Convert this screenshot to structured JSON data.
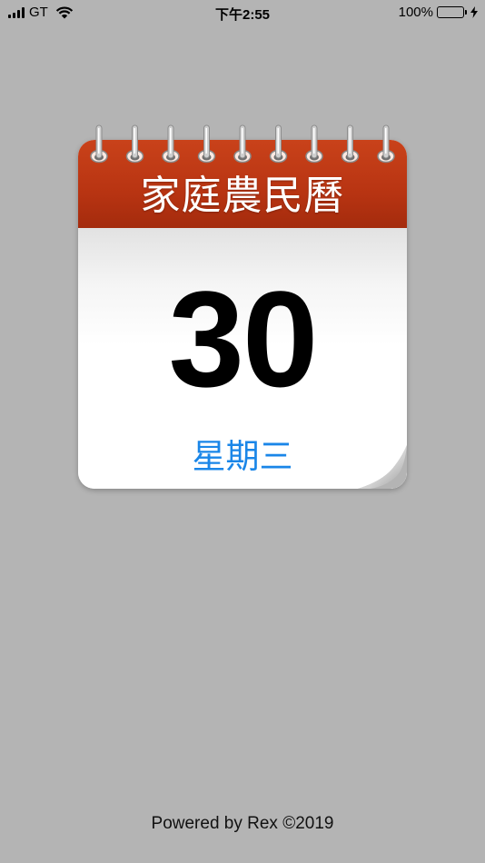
{
  "status_bar": {
    "carrier": "GT",
    "time": "下午2:55",
    "battery": "100%",
    "battery_level": 1.0
  },
  "calendar": {
    "title": "家庭農民曆",
    "day": "30",
    "weekday": "星期三",
    "header_color": "#c0391a",
    "weekday_color": "#1a86e8",
    "ring_count": 9
  },
  "footer": {
    "text": "Powered by Rex ©2019"
  },
  "icons": [
    "signal-icon",
    "wifi-icon",
    "battery-icon",
    "charging-bolt-icon",
    "spiral-ring-icon",
    "page-curl-icon"
  ]
}
